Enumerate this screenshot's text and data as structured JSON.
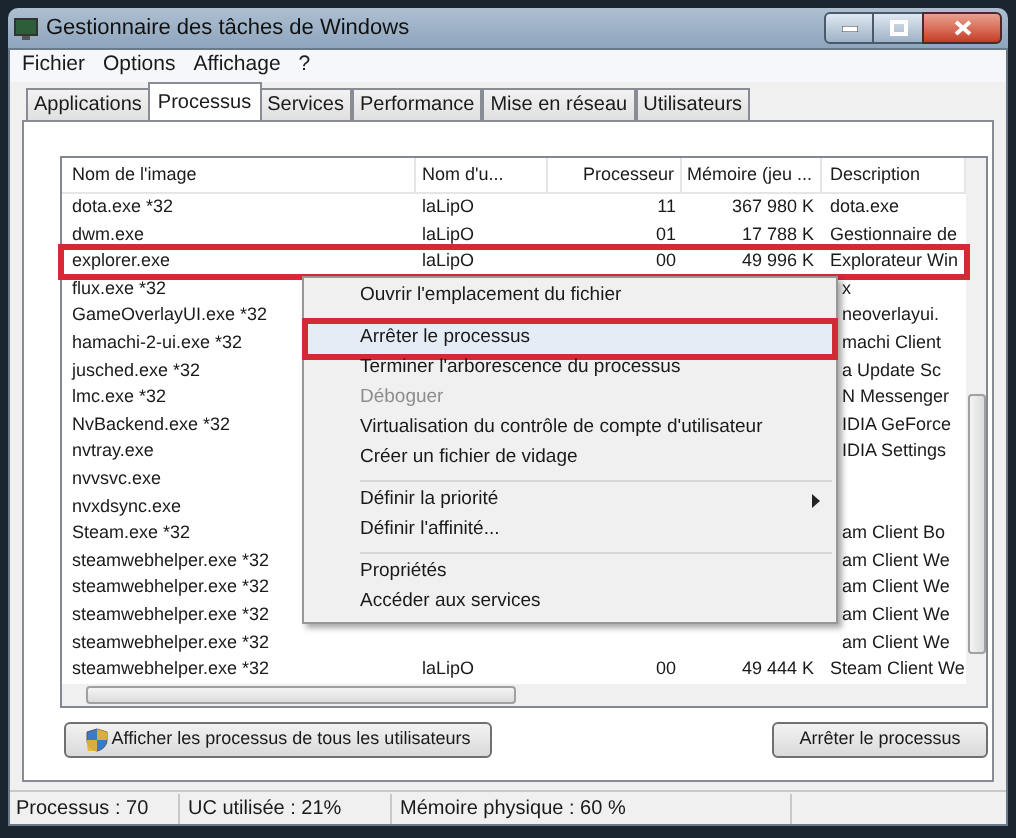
{
  "window": {
    "title": "Gestionnaire des tâches de Windows"
  },
  "menu_bar": [
    "Fichier",
    "Options",
    "Affichage",
    "?"
  ],
  "tabs": [
    {
      "label": "Applications",
      "selected": false
    },
    {
      "label": "Processus",
      "selected": true
    },
    {
      "label": "Services",
      "selected": false
    },
    {
      "label": "Performance",
      "selected": false
    },
    {
      "label": "Mise en réseau",
      "selected": false
    },
    {
      "label": "Utilisateurs",
      "selected": false
    }
  ],
  "table": {
    "columns": [
      "Nom de l'image",
      "Nom d'u...",
      "Processeur",
      "Mémoire (jeu ...",
      "Description"
    ],
    "rows": [
      {
        "name": "dota.exe *32",
        "user": "laLipO",
        "cpu": "11",
        "memory": "367 980 K",
        "description": "dota.exe",
        "marked": false
      },
      {
        "name": "dwm.exe",
        "user": "laLipO",
        "cpu": "01",
        "memory": "17 788 K",
        "description": "Gestionnaire de",
        "marked": false
      },
      {
        "name": "explorer.exe",
        "user": "laLipO",
        "cpu": "00",
        "memory": "49 996 K",
        "description": "Explorateur Win",
        "marked": true
      },
      {
        "name": "flux.exe *32",
        "description": "x",
        "marked": false
      },
      {
        "name": "GameOverlayUI.exe *32",
        "description": "neoverlayui.",
        "marked": false
      },
      {
        "name": "hamachi-2-ui.exe *32",
        "description": "machi Client",
        "marked": false
      },
      {
        "name": "jusched.exe *32",
        "description": "a Update Sc",
        "marked": false
      },
      {
        "name": "lmc.exe *32",
        "description": "N Messenger",
        "marked": false
      },
      {
        "name": "NvBackend.exe *32",
        "description": "IDIA GeForce",
        "marked": false
      },
      {
        "name": "nvtray.exe",
        "description": "IDIA Settings",
        "marked": false
      },
      {
        "name": "nvvsvc.exe",
        "marked": false
      },
      {
        "name": "nvxdsync.exe",
        "marked": false
      },
      {
        "name": "Steam.exe *32",
        "description": "am Client Bo",
        "marked": false
      },
      {
        "name": "steamwebhelper.exe *32",
        "description": "am Client We",
        "marked": false
      },
      {
        "name": "steamwebhelper.exe *32",
        "description": "am Client We",
        "marked": false
      },
      {
        "name": "steamwebhelper.exe *32",
        "description": "am Client We",
        "marked": false
      },
      {
        "name": "steamwebhelper.exe *32",
        "description": "am Client We",
        "marked": false
      },
      {
        "name": "steamwebhelper.exe *32",
        "user": "laLipO",
        "cpu": "00",
        "memory": "49 444 K",
        "description": "Steam Client We",
        "marked": false
      }
    ]
  },
  "context_menu": [
    {
      "label": "Ouvrir l'emplacement du fichier",
      "kind": "item",
      "disabled": false,
      "hovered": false,
      "marked": false
    },
    {
      "kind": "separator"
    },
    {
      "label": "Arrêter le processus",
      "kind": "item",
      "disabled": false,
      "hovered": true,
      "marked": true
    },
    {
      "label": "Terminer l'arborescence du processus",
      "kind": "item",
      "disabled": false,
      "hovered": false,
      "marked": false
    },
    {
      "label": "Déboguer",
      "kind": "item",
      "disabled": true,
      "hovered": false,
      "marked": false
    },
    {
      "label": "Virtualisation du contrôle de compte d'utilisateur",
      "kind": "item",
      "disabled": false,
      "hovered": false,
      "marked": false
    },
    {
      "label": "Créer un fichier de vidage",
      "kind": "item",
      "disabled": false,
      "hovered": false,
      "marked": false
    },
    {
      "kind": "separator"
    },
    {
      "label": "Définir la priorité",
      "kind": "submenu",
      "disabled": false,
      "hovered": false,
      "marked": false
    },
    {
      "label": "Définir l'affinité...",
      "kind": "item",
      "disabled": false,
      "hovered": false,
      "marked": false
    },
    {
      "kind": "separator"
    },
    {
      "label": "Propriétés",
      "kind": "item",
      "disabled": false,
      "hovered": false,
      "marked": false
    },
    {
      "label": "Accéder aux services",
      "kind": "item",
      "disabled": false,
      "hovered": false,
      "marked": false
    }
  ],
  "buttons": {
    "show_all": "Afficher les processus de tous les utilisateurs",
    "end_process": "Arrêter le processus"
  },
  "status_bar": [
    "Processus : 70",
    "UC utilisée : 21%",
    "Mémoire physique : 60 %"
  ]
}
